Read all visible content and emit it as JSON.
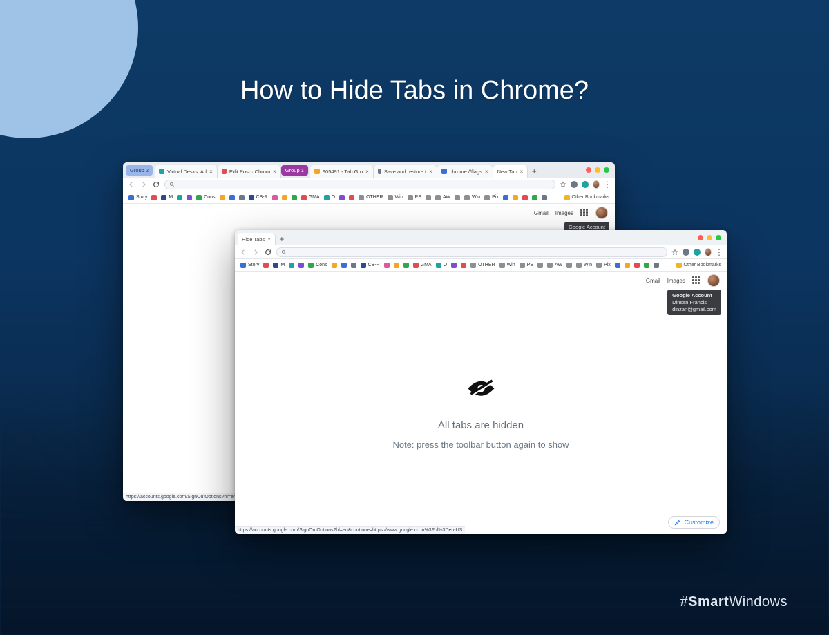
{
  "hero": {
    "title": "How to Hide Tabs in Chrome?"
  },
  "branding": {
    "prefix": "#",
    "bold": "Smart",
    "thin": "Windows"
  },
  "windowBack": {
    "tabs": {
      "group1": "Group 2",
      "tab_virtual": "Virtual Desks: Ad",
      "tab_edit": "Edit Post · Chrom",
      "group2": "Group 1",
      "tab_bug": "905491 - Tab Gro",
      "tab_save": "Save and restore t",
      "tab_flags": "chrome://flags",
      "tab_new": "New Tab"
    },
    "addressbar": {
      "text": ""
    },
    "ntp": {
      "gmail": "Gmail",
      "images": "Images",
      "tooltip_title": "Google Account"
    },
    "statusbar": "https://accounts.google.com/SignOutOptions?hl=en&continue=https://"
  },
  "windowFront": {
    "tabs": {
      "tab_hide": "Hide Tabs"
    },
    "addressbar": {
      "text": ""
    },
    "ntp": {
      "gmail": "Gmail",
      "images": "Images",
      "tooltip_title": "Google Account",
      "tooltip_name": "Dinsan Francis",
      "tooltip_email": "dinzan@gmail.com"
    },
    "message": {
      "main": "All tabs are hidden",
      "sub": "Note: press the toolbar button again to show"
    },
    "customize": "Customize",
    "statusbar": "https://accounts.google.com/SignOutOptions?hl=en&continue=https://www.google.co.in%3Fhl%3Den-US"
  },
  "bookmarks": [
    {
      "label": "Story",
      "color": "c-blue"
    },
    {
      "label": "",
      "color": "c-red"
    },
    {
      "label": "M",
      "color": "c-dblue"
    },
    {
      "label": "",
      "color": "c-teal"
    },
    {
      "label": "",
      "color": "c-purple"
    },
    {
      "label": "Cons",
      "color": "c-green"
    },
    {
      "label": "",
      "color": "c-orange"
    },
    {
      "label": "",
      "color": "c-blue"
    },
    {
      "label": "",
      "color": "c-gray"
    },
    {
      "label": "CB-R",
      "color": "c-dblue"
    },
    {
      "label": "",
      "color": "c-pink"
    },
    {
      "label": "",
      "color": "c-orange"
    },
    {
      "label": "",
      "color": "c-green"
    },
    {
      "label": "GMA",
      "color": "c-red"
    },
    {
      "label": "O",
      "color": "c-teal"
    },
    {
      "label": "",
      "color": "c-purple"
    },
    {
      "label": "",
      "color": "c-red"
    },
    {
      "label": "OTHER",
      "color": "folder"
    },
    {
      "label": "Win",
      "color": "folder"
    },
    {
      "label": "PS",
      "color": "folder"
    },
    {
      "label": "",
      "color": "folder"
    },
    {
      "label": "AW",
      "color": "folder"
    },
    {
      "label": "",
      "color": "folder"
    },
    {
      "label": "Win",
      "color": "folder"
    },
    {
      "label": "Pix",
      "color": "folder"
    },
    {
      "label": "",
      "color": "c-blue"
    },
    {
      "label": "",
      "color": "c-orange"
    },
    {
      "label": "",
      "color": "c-red"
    },
    {
      "label": "",
      "color": "c-green"
    },
    {
      "label": "",
      "color": "c-gray"
    }
  ],
  "otherBookmarks": "Other Bookmarks"
}
